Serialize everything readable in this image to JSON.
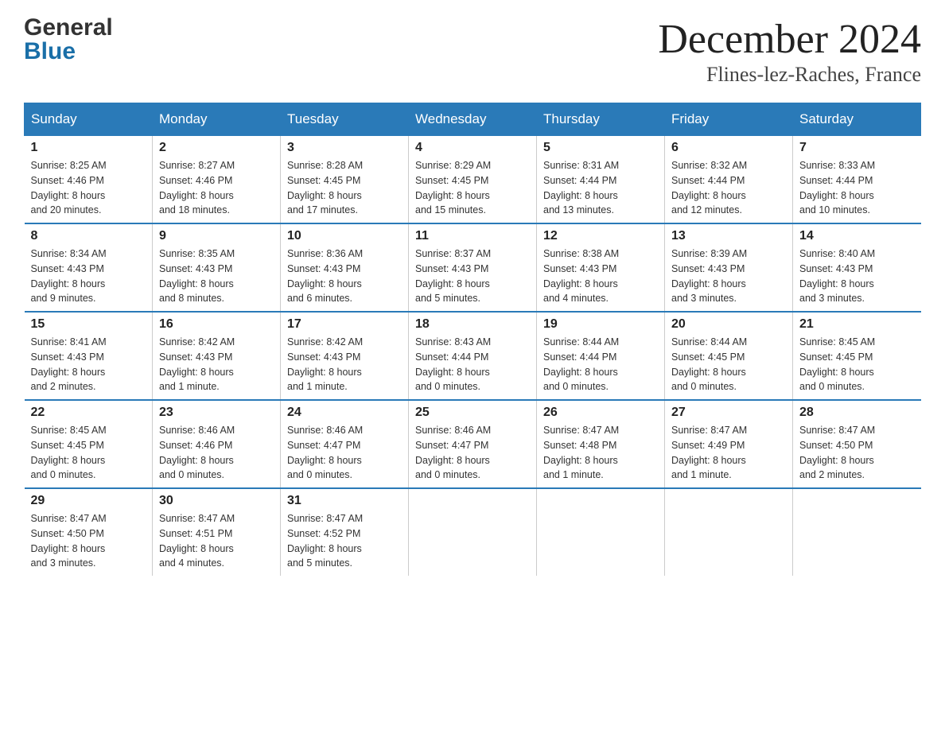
{
  "header": {
    "logo_line1": "General",
    "logo_line2": "Blue",
    "month_title": "December 2024",
    "location": "Flines-lez-Raches, France"
  },
  "days_of_week": [
    "Sunday",
    "Monday",
    "Tuesday",
    "Wednesday",
    "Thursday",
    "Friday",
    "Saturday"
  ],
  "weeks": [
    [
      {
        "day": "1",
        "sunrise": "8:25 AM",
        "sunset": "4:46 PM",
        "daylight": "8 hours and 20 minutes."
      },
      {
        "day": "2",
        "sunrise": "8:27 AM",
        "sunset": "4:46 PM",
        "daylight": "8 hours and 18 minutes."
      },
      {
        "day": "3",
        "sunrise": "8:28 AM",
        "sunset": "4:45 PM",
        "daylight": "8 hours and 17 minutes."
      },
      {
        "day": "4",
        "sunrise": "8:29 AM",
        "sunset": "4:45 PM",
        "daylight": "8 hours and 15 minutes."
      },
      {
        "day": "5",
        "sunrise": "8:31 AM",
        "sunset": "4:44 PM",
        "daylight": "8 hours and 13 minutes."
      },
      {
        "day": "6",
        "sunrise": "8:32 AM",
        "sunset": "4:44 PM",
        "daylight": "8 hours and 12 minutes."
      },
      {
        "day": "7",
        "sunrise": "8:33 AM",
        "sunset": "4:44 PM",
        "daylight": "8 hours and 10 minutes."
      }
    ],
    [
      {
        "day": "8",
        "sunrise": "8:34 AM",
        "sunset": "4:43 PM",
        "daylight": "8 hours and 9 minutes."
      },
      {
        "day": "9",
        "sunrise": "8:35 AM",
        "sunset": "4:43 PM",
        "daylight": "8 hours and 8 minutes."
      },
      {
        "day": "10",
        "sunrise": "8:36 AM",
        "sunset": "4:43 PM",
        "daylight": "8 hours and 6 minutes."
      },
      {
        "day": "11",
        "sunrise": "8:37 AM",
        "sunset": "4:43 PM",
        "daylight": "8 hours and 5 minutes."
      },
      {
        "day": "12",
        "sunrise": "8:38 AM",
        "sunset": "4:43 PM",
        "daylight": "8 hours and 4 minutes."
      },
      {
        "day": "13",
        "sunrise": "8:39 AM",
        "sunset": "4:43 PM",
        "daylight": "8 hours and 3 minutes."
      },
      {
        "day": "14",
        "sunrise": "8:40 AM",
        "sunset": "4:43 PM",
        "daylight": "8 hours and 3 minutes."
      }
    ],
    [
      {
        "day": "15",
        "sunrise": "8:41 AM",
        "sunset": "4:43 PM",
        "daylight": "8 hours and 2 minutes."
      },
      {
        "day": "16",
        "sunrise": "8:42 AM",
        "sunset": "4:43 PM",
        "daylight": "8 hours and 1 minute."
      },
      {
        "day": "17",
        "sunrise": "8:42 AM",
        "sunset": "4:43 PM",
        "daylight": "8 hours and 1 minute."
      },
      {
        "day": "18",
        "sunrise": "8:43 AM",
        "sunset": "4:44 PM",
        "daylight": "8 hours and 0 minutes."
      },
      {
        "day": "19",
        "sunrise": "8:44 AM",
        "sunset": "4:44 PM",
        "daylight": "8 hours and 0 minutes."
      },
      {
        "day": "20",
        "sunrise": "8:44 AM",
        "sunset": "4:45 PM",
        "daylight": "8 hours and 0 minutes."
      },
      {
        "day": "21",
        "sunrise": "8:45 AM",
        "sunset": "4:45 PM",
        "daylight": "8 hours and 0 minutes."
      }
    ],
    [
      {
        "day": "22",
        "sunrise": "8:45 AM",
        "sunset": "4:45 PM",
        "daylight": "8 hours and 0 minutes."
      },
      {
        "day": "23",
        "sunrise": "8:46 AM",
        "sunset": "4:46 PM",
        "daylight": "8 hours and 0 minutes."
      },
      {
        "day": "24",
        "sunrise": "8:46 AM",
        "sunset": "4:47 PM",
        "daylight": "8 hours and 0 minutes."
      },
      {
        "day": "25",
        "sunrise": "8:46 AM",
        "sunset": "4:47 PM",
        "daylight": "8 hours and 0 minutes."
      },
      {
        "day": "26",
        "sunrise": "8:47 AM",
        "sunset": "4:48 PM",
        "daylight": "8 hours and 1 minute."
      },
      {
        "day": "27",
        "sunrise": "8:47 AM",
        "sunset": "4:49 PM",
        "daylight": "8 hours and 1 minute."
      },
      {
        "day": "28",
        "sunrise": "8:47 AM",
        "sunset": "4:50 PM",
        "daylight": "8 hours and 2 minutes."
      }
    ],
    [
      {
        "day": "29",
        "sunrise": "8:47 AM",
        "sunset": "4:50 PM",
        "daylight": "8 hours and 3 minutes."
      },
      {
        "day": "30",
        "sunrise": "8:47 AM",
        "sunset": "4:51 PM",
        "daylight": "8 hours and 4 minutes."
      },
      {
        "day": "31",
        "sunrise": "8:47 AM",
        "sunset": "4:52 PM",
        "daylight": "8 hours and 5 minutes."
      },
      null,
      null,
      null,
      null
    ]
  ],
  "labels": {
    "sunrise": "Sunrise:",
    "sunset": "Sunset:",
    "daylight": "Daylight:"
  }
}
